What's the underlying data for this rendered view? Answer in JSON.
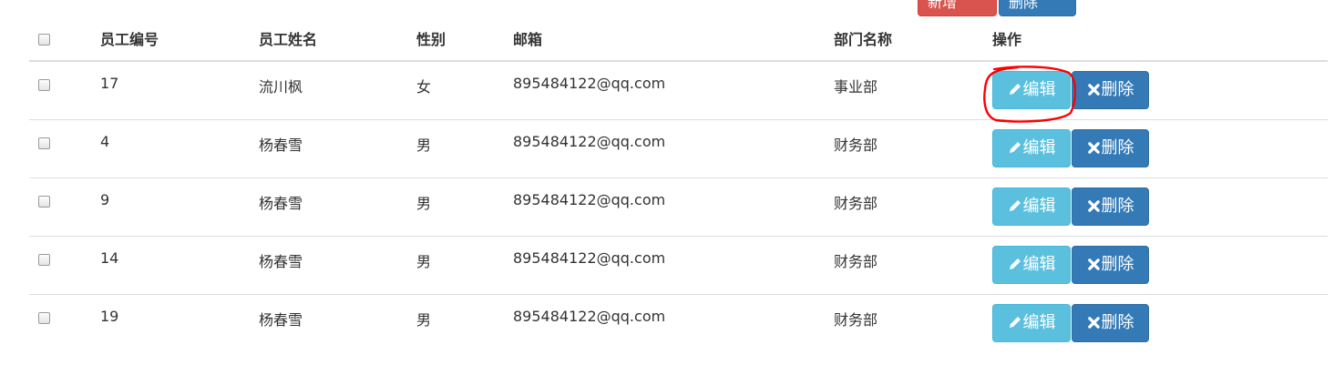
{
  "toolbar": {
    "add_label": "新增",
    "delete_label": "删除"
  },
  "table": {
    "headers": {
      "id": "员工编号",
      "name": "员工姓名",
      "gender": "性别",
      "email": "邮箱",
      "dept": "部门名称",
      "ops": "操作"
    },
    "rows": [
      {
        "id": "17",
        "name": "流川枫",
        "gender": "女",
        "email": "895484122@qq.com",
        "dept": "事业部",
        "edit": "编辑",
        "delete": "删除"
      },
      {
        "id": "4",
        "name": "杨春雪",
        "gender": "男",
        "email": "895484122@qq.com",
        "dept": "财务部",
        "edit": "编辑",
        "delete": "删除"
      },
      {
        "id": "9",
        "name": "杨春雪",
        "gender": "男",
        "email": "895484122@qq.com",
        "dept": "财务部",
        "edit": "编辑",
        "delete": "删除"
      },
      {
        "id": "14",
        "name": "杨春雪",
        "gender": "男",
        "email": "895484122@qq.com",
        "dept": "财务部",
        "edit": "编辑",
        "delete": "删除"
      },
      {
        "id": "19",
        "name": "杨春雪",
        "gender": "男",
        "email": "895484122@qq.com",
        "dept": "财务部",
        "edit": "编辑",
        "delete": "删除"
      }
    ]
  },
  "colors": {
    "edit_button": "#5bc0de",
    "delete_button": "#337ab7",
    "add_button": "#d9534f",
    "annotation": "#ff0000"
  }
}
